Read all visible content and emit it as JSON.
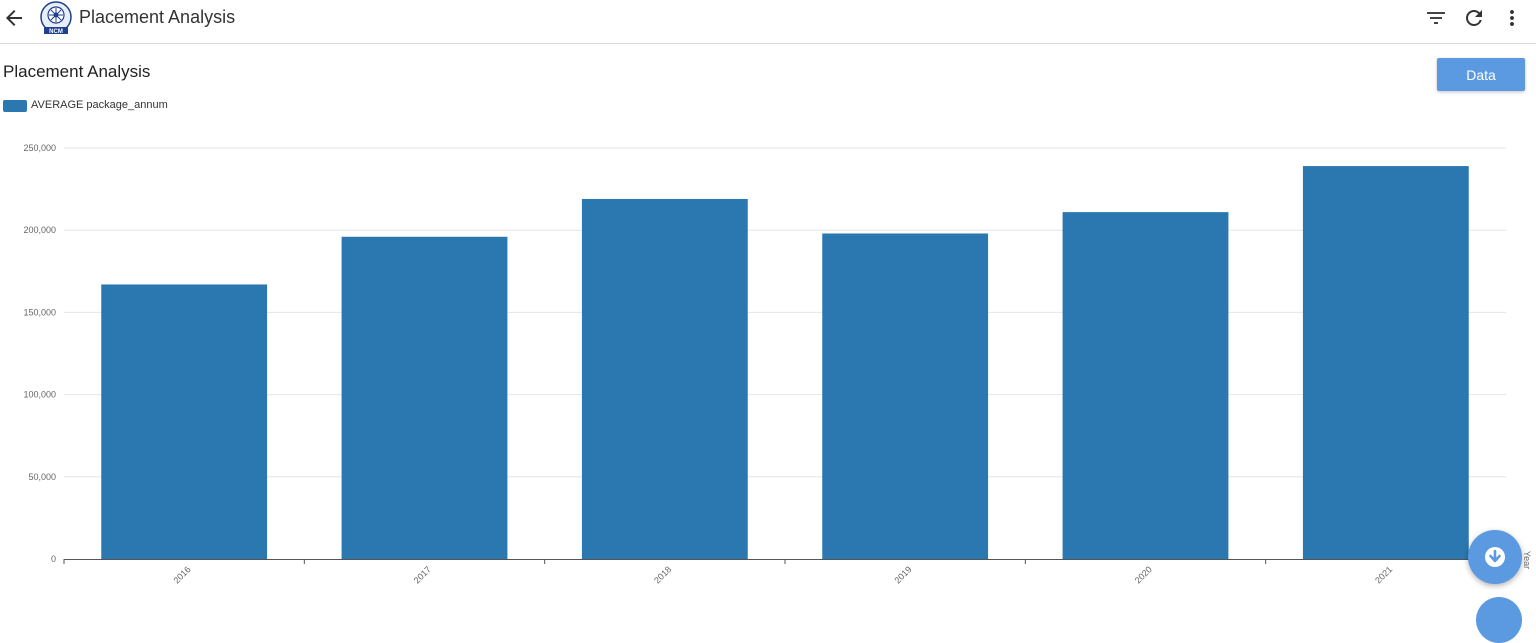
{
  "header": {
    "title": "Placement Analysis",
    "logo_text": "NCM",
    "icons": [
      "back-arrow-icon",
      "filter-icon",
      "refresh-icon",
      "more-vert-icon"
    ]
  },
  "main": {
    "chart_title": "Placement Analysis",
    "data_button_label": "Data",
    "download_icon": "download-icon"
  },
  "colors": {
    "bar": "#2b78b0",
    "button": "#5b9ae0",
    "grid": "#e6e6e6"
  },
  "chart_data": {
    "type": "bar",
    "categories": [
      "2016",
      "2017",
      "2018",
      "2019",
      "2020",
      "2021"
    ],
    "series": [
      {
        "name": "AVERAGE package_annum",
        "values": [
          167000,
          196000,
          219000,
          198000,
          211000,
          239000
        ]
      }
    ],
    "xlabel": "Year",
    "ylabel": "",
    "ylim": [
      0,
      250000
    ],
    "yticks": [
      "0",
      "50,000",
      "100,000",
      "150,000",
      "200,000",
      "250,000"
    ],
    "grid": true,
    "legend_position": "top-left"
  }
}
